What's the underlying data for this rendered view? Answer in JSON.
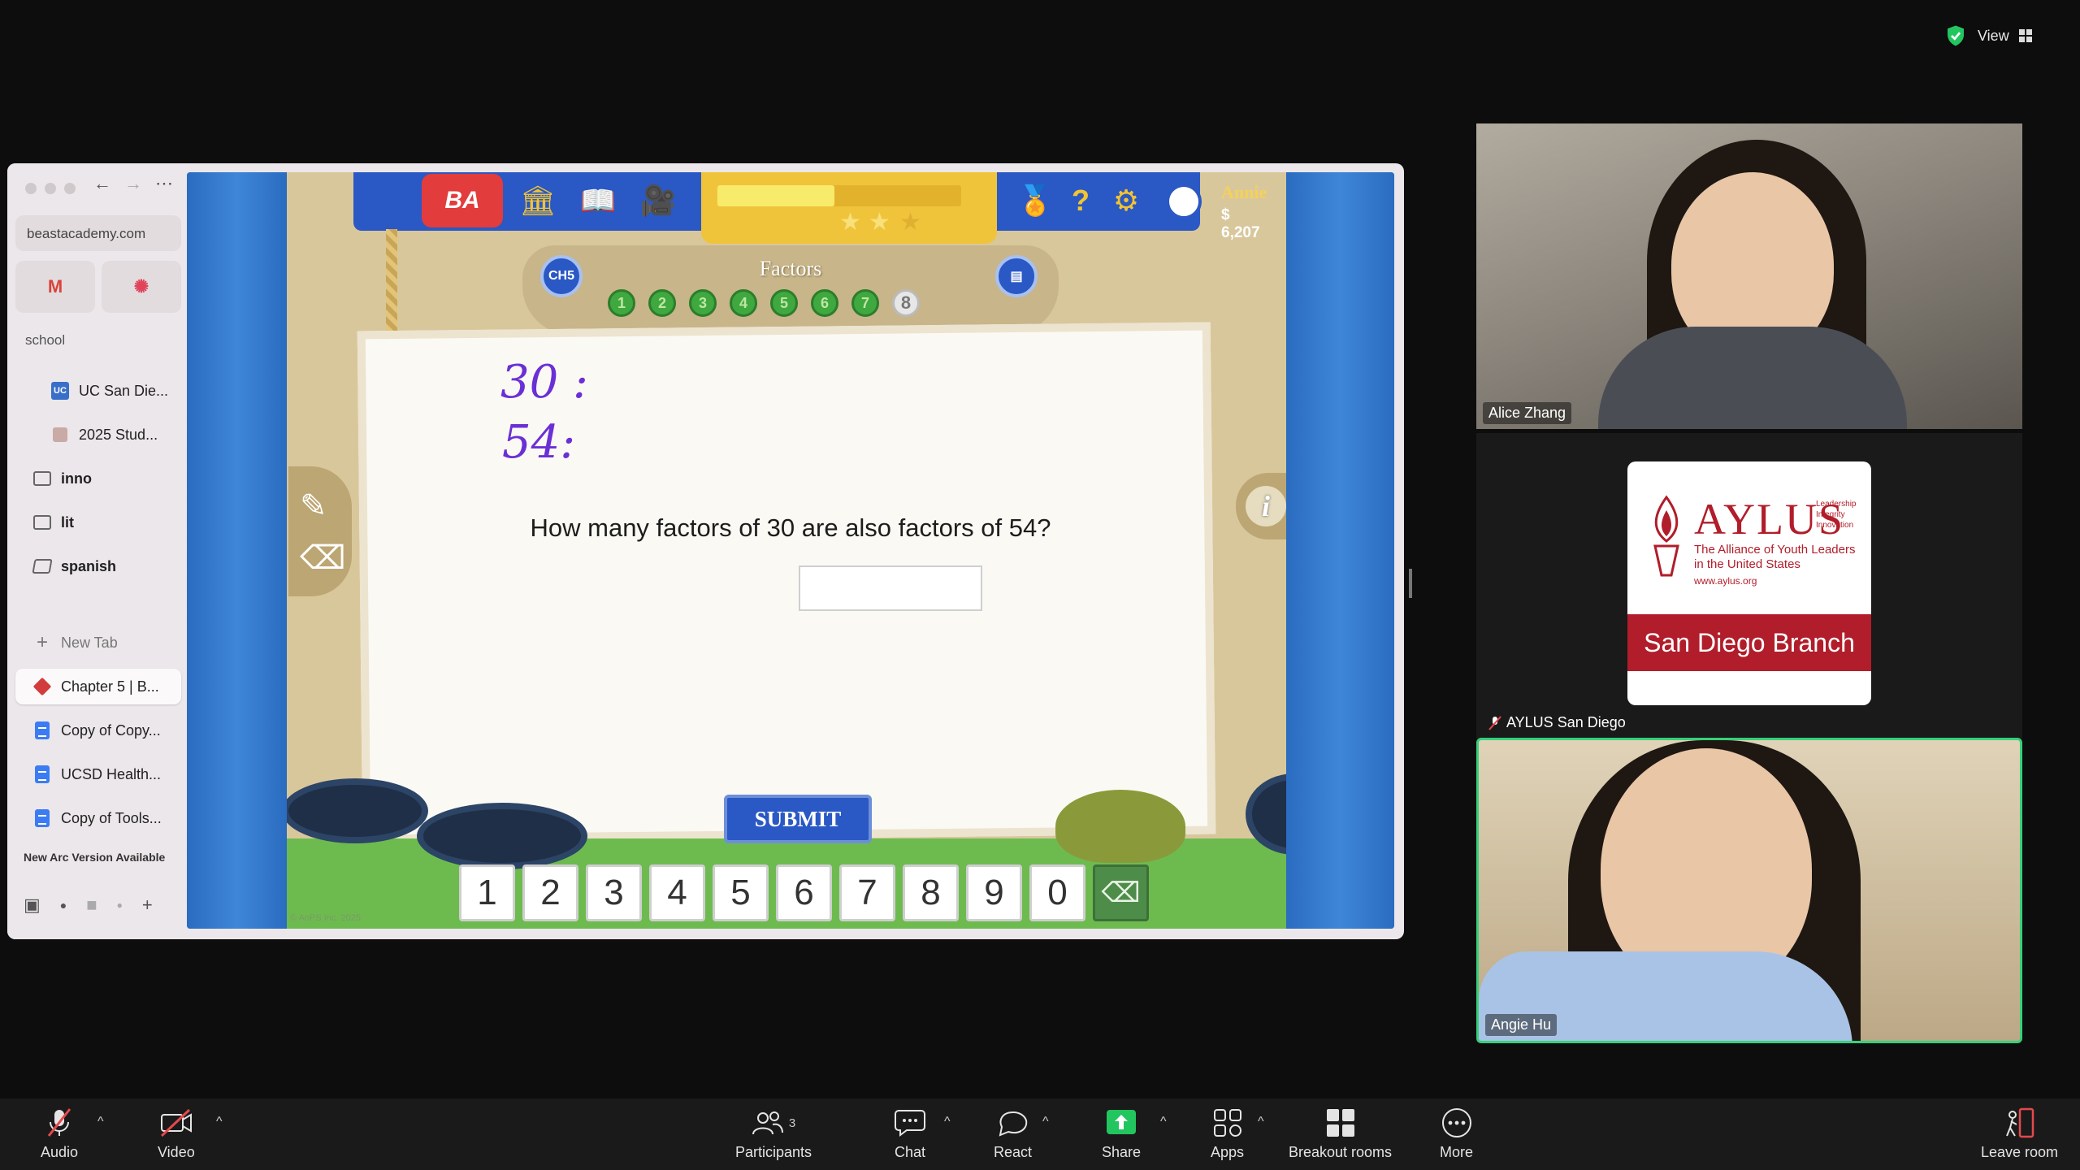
{
  "top": {
    "view_label": "View"
  },
  "browser": {
    "url": "beastacademy.com",
    "pinned": [
      "M",
      "✺"
    ],
    "section_label": "school",
    "items": [
      {
        "label": "UC San Die..."
      },
      {
        "label": "2025 Stud..."
      },
      {
        "label": "inno"
      },
      {
        "label": "lit"
      },
      {
        "label": "spanish"
      },
      {
        "label": "New Tab"
      },
      {
        "label": "Chapter 5 | B..."
      },
      {
        "label": "Copy of Copy..."
      },
      {
        "label": "UCSD Health..."
      },
      {
        "label": "Copy of Tools..."
      }
    ],
    "update_notice": "New Arc Version Available"
  },
  "game": {
    "logo": "BA",
    "ch_badge": "CH5",
    "user_name": "Annie",
    "coins": "$ 6,207",
    "progress_fraction": 0.48,
    "stars_filled": 2,
    "stars_total": 3,
    "lesson_title": "Factors",
    "levels": [
      "1",
      "2",
      "3",
      "4",
      "5",
      "6",
      "7",
      "8"
    ],
    "current_level": "8",
    "handwriting_1": "30 :",
    "handwriting_2": "54:",
    "question": "How many factors of 30 are also factors of 54?",
    "answer_value": "",
    "submit_label": "SUBMIT",
    "keypad": [
      "1",
      "2",
      "3",
      "4",
      "5",
      "6",
      "7",
      "8",
      "9",
      "0"
    ],
    "backspace": "⌫",
    "info_label": "i",
    "copyright": "© AoPS Inc. 2025"
  },
  "participants": [
    {
      "name": "Alice Zhang"
    },
    {
      "name": "AYLUS San Diego",
      "card_title": "AYLUS",
      "card_small": "Leadership\nIntegrity\nInnovation",
      "card_sub": "The Alliance of Youth Leaders\nin the United States",
      "card_url": "www.aylus.org",
      "card_branch": "San Diego Branch"
    },
    {
      "name": "Angie Hu"
    }
  ],
  "toolbar": {
    "audio": "Audio",
    "video": "Video",
    "participants": "Participants",
    "participants_count": "3",
    "chat": "Chat",
    "react": "React",
    "share": "Share",
    "apps": "Apps",
    "breakout": "Breakout rooms",
    "more": "More",
    "leave": "Leave room"
  },
  "colors": {
    "active_speaker": "#36d17b",
    "share_green": "#22c55e",
    "muted_red": "#e5484d",
    "ba_blue": "#2a58c4"
  }
}
